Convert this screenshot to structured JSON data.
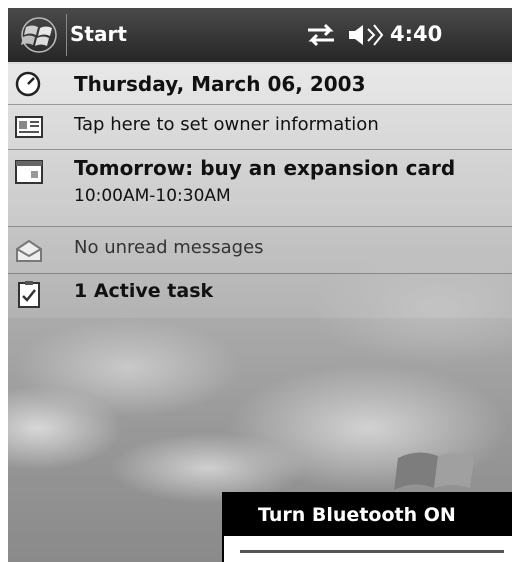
{
  "taskbar": {
    "start_label": "Start",
    "time": "4:40",
    "icons": [
      "windows-flag-icon",
      "connectivity-icon",
      "speaker-icon"
    ]
  },
  "today": {
    "date": "Thursday, March 06, 2003",
    "owner": "Tap here to set owner information",
    "appointment_title": "Tomorrow: buy an expansion card",
    "appointment_time": "10:00AM-10:30AM",
    "messages": "No unread messages",
    "tasks": "1 Active task",
    "icons": [
      "clock-icon",
      "owner-card-icon",
      "calendar-icon",
      "envelope-icon",
      "clipboard-icon"
    ]
  },
  "context_menu": {
    "items": [
      "Turn Bluetooth ON"
    ]
  }
}
